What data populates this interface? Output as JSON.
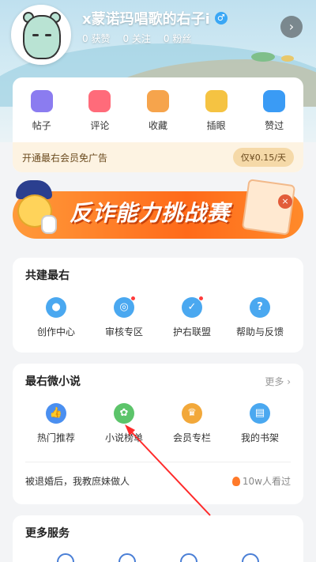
{
  "profile": {
    "username": "x蒙诺玛唱歌的右子i",
    "gender_icon": "male-icon",
    "likes": "0 获赞",
    "following": "0 关注",
    "fans": "0 粉丝",
    "arrow": "›"
  },
  "quick": {
    "items": [
      {
        "label": "帖子",
        "icon": "post-icon",
        "color": "#8b7cf0"
      },
      {
        "label": "评论",
        "icon": "comment-icon",
        "color": "#ff6b7a"
      },
      {
        "label": "收藏",
        "icon": "favorite-icon",
        "color": "#f6a44c"
      },
      {
        "label": "插眼",
        "icon": "eye-icon",
        "color": "#f5c342"
      },
      {
        "label": "赞过",
        "icon": "thumb-up-icon",
        "color": "#3a9bf5"
      }
    ],
    "vip_text": "开通最右会员免广告",
    "vip_price": "仅¥0.15/天"
  },
  "banner": {
    "title": "反诈能力挑战赛",
    "close": "×"
  },
  "build": {
    "title": "共建最右",
    "items": [
      {
        "label": "创作中心",
        "icon": "bulb-icon",
        "color": "#4aa8f0",
        "glyph": "●"
      },
      {
        "label": "审核专区",
        "icon": "search-icon",
        "color": "#4aa8f0",
        "glyph": "◎"
      },
      {
        "label": "护右联盟",
        "icon": "shield-icon",
        "color": "#4aa8f0",
        "glyph": "✓"
      },
      {
        "label": "帮助与反馈",
        "icon": "help-icon",
        "color": "#4aa8f0",
        "glyph": "?"
      }
    ]
  },
  "novel": {
    "title": "最右微小说",
    "more": "更多 ›",
    "items": [
      {
        "label": "热门推荐",
        "icon": "thumb-up-icon",
        "color": "#4a8ff0",
        "glyph": "👍"
      },
      {
        "label": "小说榜单",
        "icon": "medal-icon",
        "color": "#5cc46a",
        "glyph": "✿"
      },
      {
        "label": "会员专栏",
        "icon": "crown-icon",
        "color": "#f2a83a",
        "glyph": "♛"
      },
      {
        "label": "我的书架",
        "icon": "book-icon",
        "color": "#4aa8f0",
        "glyph": "▤"
      }
    ],
    "recommend_text": "被退婚后，我教庶妹做人",
    "hot_count": "10w人看过"
  },
  "more_services": {
    "title": "更多服务"
  }
}
